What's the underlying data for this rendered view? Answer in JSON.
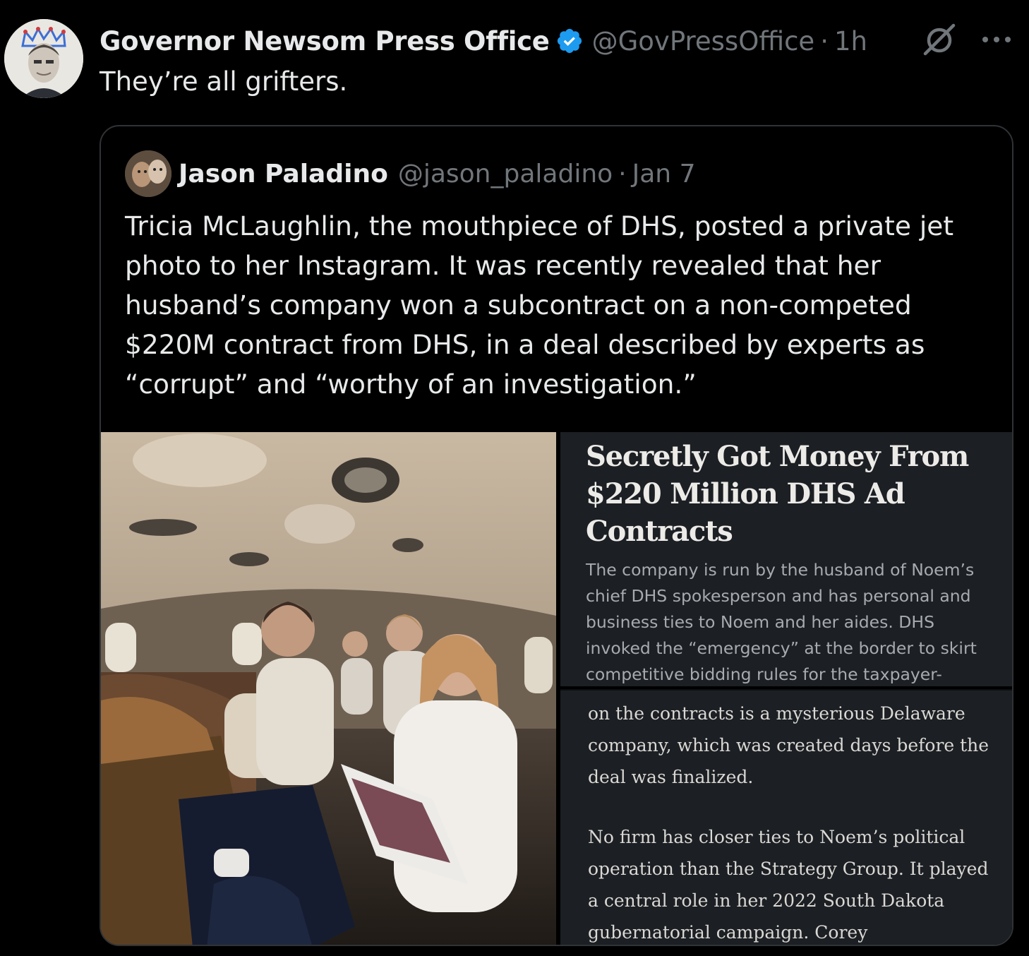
{
  "tweet": {
    "display_name": "Governor Newsom Press Office",
    "handle": "@GovPressOffice",
    "separator": "·",
    "time": "1h",
    "text": "They’re all grifters.",
    "verified_icon": "verified-badge-icon",
    "grok_icon": "grok-icon",
    "more_icon": "more-icon",
    "more_label": "···"
  },
  "quote": {
    "display_name": "Jason Paladino",
    "handle": "@jason_paladino",
    "separator": "·",
    "time": "Jan 7",
    "text": "Tricia McLaughlin, the mouthpiece of DHS, posted a private jet photo to her Instagram. It was recently revealed that her husband’s company won a subcontract on a non-competed $220M contract from DHS, in a deal described by experts as “corrupt” and “worthy of an investigation.”"
  },
  "article": {
    "headline": "Secretly Got Money From $220 Million DHS Ad Contracts",
    "dek": "The company is run by the husband of Noem’s chief DHS spokesperson and has personal and business ties to Noem and her aides. DHS invoked the “emergency” at the border to skirt competitive bidding rules for the taxpayer-",
    "paragraph_1": "on the contracts is a mysterious Delaware company, which was created days before the deal was finalized.",
    "paragraph_2": "No firm has closer ties to Noem’s political operation than the Strategy Group. It played a central role in her 2022 South Dakota gubernatorial campaign. Corey Lewandowski,"
  },
  "colors": {
    "background": "#000000",
    "text_primary": "#e7e9ea",
    "text_secondary": "#71767b",
    "verified_blue": "#1d9bf0",
    "card_border": "#2f3336",
    "article_bg": "#1c1f23"
  }
}
